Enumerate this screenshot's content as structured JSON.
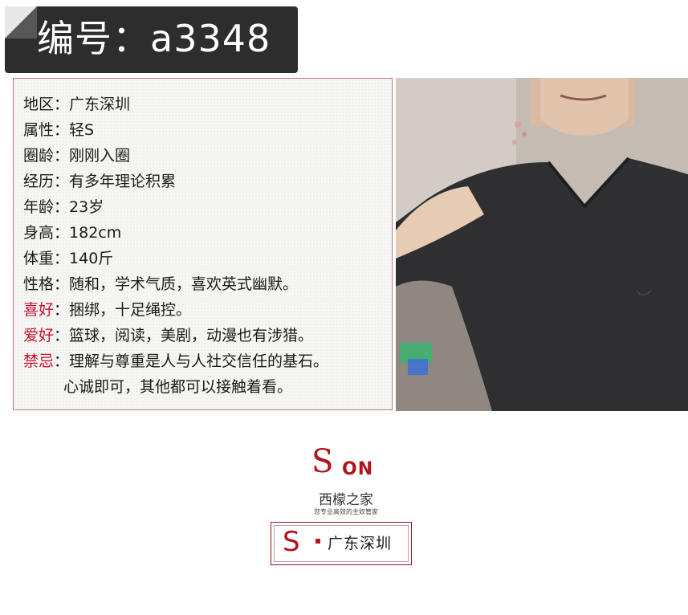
{
  "header": {
    "title": "编号：a3348"
  },
  "profile": {
    "rows": [
      {
        "label": "地区：",
        "value": "广东深圳",
        "highlight": false
      },
      {
        "label": "属性：",
        "value": "轻S",
        "highlight": false
      },
      {
        "label": "圈龄：",
        "value": "刚刚入圈",
        "highlight": false
      },
      {
        "label": "经历：",
        "value": "有多年理论积累",
        "highlight": false
      },
      {
        "label": "年龄：",
        "value": "23岁",
        "highlight": false
      },
      {
        "label": "身高：",
        "value": "182cm",
        "highlight": false
      },
      {
        "label": "体重：",
        "value": "140斤",
        "highlight": false
      },
      {
        "label": "性格：",
        "value": "随和，学术气质，喜欢英式幽默。",
        "highlight": false
      },
      {
        "label": "喜好",
        "sep": "：",
        "value": "捆绑，十足绳控。",
        "highlight": true
      },
      {
        "label": "爱好",
        "sep": "：",
        "value": "篮球，阅读，美剧，动漫也有涉猎。",
        "highlight": true
      },
      {
        "label": "禁忌",
        "sep": "：",
        "value": "理解与尊重是人与人社交信任的基石。",
        "highlight": true
      }
    ],
    "continuation": "心诚即可，其他都可以接触着看。",
    "label_highlight_color": "#c8102e"
  },
  "logo": {
    "mark_s": "S",
    "mark_on": "ON",
    "name": "西檬之家",
    "tagline": "您专业高效的主奴管家",
    "brand_color": "#b1121c"
  },
  "region_badge": {
    "letter": "S",
    "text": "广东深圳"
  },
  "photo": {
    "icon": "person-photo"
  }
}
